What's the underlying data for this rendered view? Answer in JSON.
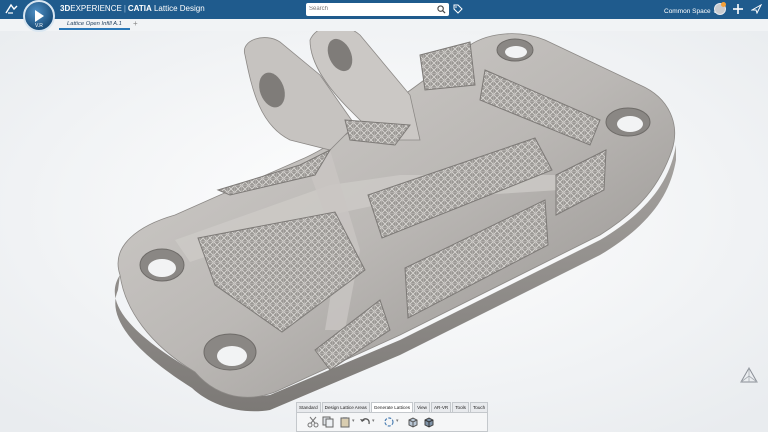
{
  "header": {
    "brand_bold": "3D",
    "brand_rest": "EXPERIENCE",
    "app_name": "CATIA",
    "app_role": "Lattice Design",
    "compass_version": "V.R",
    "search_placeholder": "Search",
    "space_label": "Common Space",
    "accent": "#1f5b8d"
  },
  "tabs": [
    {
      "label": "Lattice Open Infill A.1",
      "active": true
    }
  ],
  "action_bar": {
    "tabs": [
      "Standard",
      "Design Lattice Areas",
      "Generate Lattices",
      "View",
      "AR-VR",
      "Tools",
      "Touch"
    ],
    "active_tab": "Generate Lattices",
    "tools": [
      "scissors-icon",
      "copy-icon",
      "paste-icon",
      "undo-icon",
      "update-icon",
      "lattice-cube-icon",
      "shaded-cube-icon"
    ]
  },
  "viewport": {
    "part_color": "#b9b6b3"
  }
}
